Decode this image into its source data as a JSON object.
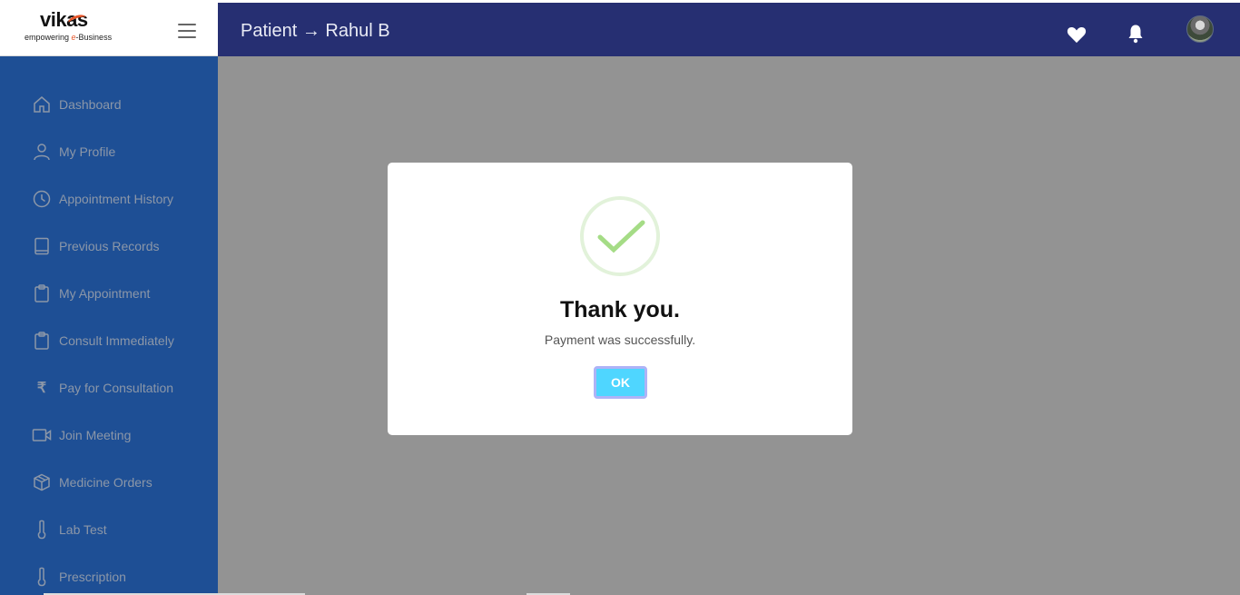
{
  "logo": {
    "word": "vikas",
    "tagline_before": "empowering ",
    "tagline_e": "e",
    "tagline_after": "-Business"
  },
  "header": {
    "breadcrumb": "Patient → Rahul B",
    "icons": [
      "heart-icon",
      "bell-icon",
      "avatar"
    ]
  },
  "sidebar": {
    "items": [
      {
        "label": "Dashboard",
        "icon": "home-icon"
      },
      {
        "label": "My Profile",
        "icon": "user-icon"
      },
      {
        "label": "Appointment History",
        "icon": "clock-icon"
      },
      {
        "label": "Previous Records",
        "icon": "book-icon"
      },
      {
        "label": "My Appointment",
        "icon": "clipboard-icon"
      },
      {
        "label": "Consult Immediately",
        "icon": "clipboard-icon"
      },
      {
        "label": "Pay for Consultation",
        "icon": "rupee-icon",
        "glyph": "₹"
      },
      {
        "label": "Join Meeting",
        "icon": "video-icon"
      },
      {
        "label": "Medicine Orders",
        "icon": "box-icon"
      },
      {
        "label": "Lab Test",
        "icon": "thermometer-icon"
      },
      {
        "label": "Prescription",
        "icon": "thermometer-icon"
      }
    ]
  },
  "modal": {
    "title": "Thank you.",
    "message": "Payment was successfully.",
    "ok_label": "OK"
  },
  "colors": {
    "header_bg": "#262f72",
    "sidebar_bg": "#1e4f95",
    "overlay_bg": "#939393",
    "ok_button": "#4fd6ff",
    "success_check": "#a5dc86"
  }
}
